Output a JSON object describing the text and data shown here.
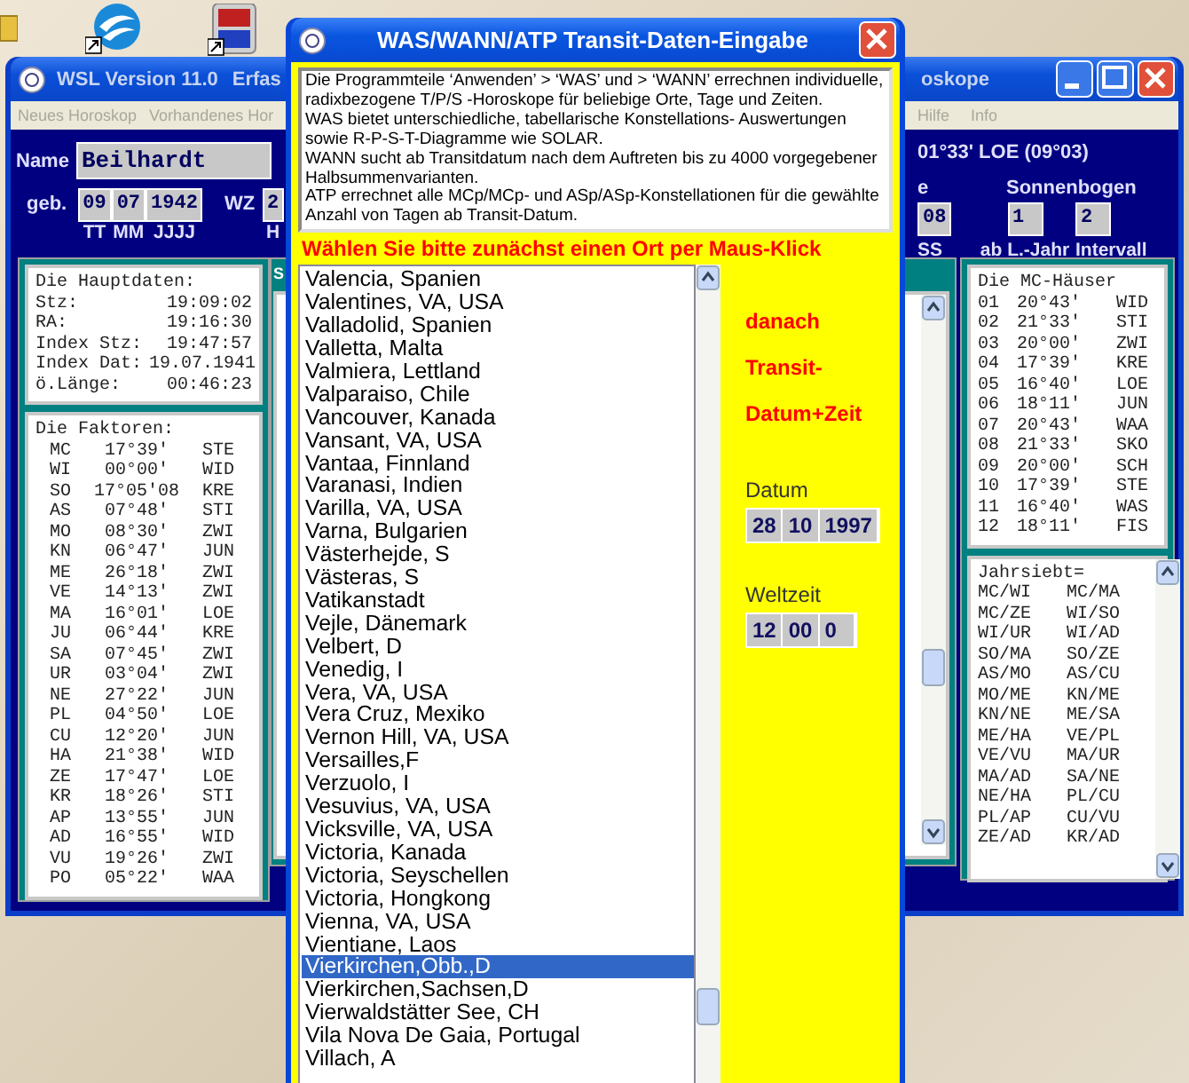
{
  "main_window": {
    "title_fragments": [
      "WSL Version 11.0",
      "Erfas",
      "oskope"
    ],
    "menu": [
      {
        "label": "Neues Horoskop",
        "disabled": true
      },
      {
        "label": "Vorhandenes Hor",
        "disabled": true
      },
      {
        "label": "Hilfe",
        "disabled": true
      },
      {
        "label": "Info",
        "disabled": true
      }
    ],
    "name_label": "Name",
    "name_value": "Beilhardt",
    "birth_label": "geb.",
    "birth_fields": [
      {
        "value": "09",
        "caption": "TT"
      },
      {
        "value": "07",
        "caption": "MM"
      },
      {
        "value": "1942",
        "caption": "JJJJ"
      }
    ],
    "wz_label": "WZ",
    "wz_value": "2",
    "wz_caption": "H",
    "position_text": "01°33' LOE (09°03)",
    "time_label": "e",
    "time_field": {
      "value": "08",
      "caption": "SS"
    },
    "sonnenbogen_label": "Sonnenbogen",
    "sonnenbogen_fields": [
      {
        "value": "1",
        "caption": "ab L.-Jahr"
      },
      {
        "value": "2",
        "caption": "Intervall"
      }
    ],
    "hauptdaten": {
      "title": "Die Hauptdaten:",
      "rows": [
        [
          "Stz:",
          "19:09:02"
        ],
        [
          "RA:",
          "19:16:30"
        ],
        [
          "Index Stz:",
          "19:47:57"
        ],
        [
          "Index Dat:",
          "19.07.1941"
        ],
        [
          "ö.Länge:",
          "00:46:23"
        ]
      ]
    },
    "faktoren": {
      "title": "Die Faktoren:",
      "rows": [
        [
          "MC",
          "17°39'",
          "STE"
        ],
        [
          "WI",
          "00°00'",
          "WID"
        ],
        [
          "SO",
          "17°05'08",
          "KRE"
        ],
        [
          "AS",
          "07°48'",
          "STI"
        ],
        [
          "MO",
          "08°30'",
          "ZWI"
        ],
        [
          "KN",
          "06°47'",
          "JUN"
        ],
        [
          "ME",
          "26°18'",
          "ZWI"
        ],
        [
          "VE",
          "14°13'",
          "ZWI"
        ],
        [
          "MA",
          "16°01'",
          "LOE"
        ],
        [
          "JU",
          "06°44'",
          "KRE"
        ],
        [
          "SA",
          "07°45'",
          "ZWI"
        ],
        [
          "UR",
          "03°04'",
          "ZWI"
        ],
        [
          "NE",
          "27°22'",
          "JUN"
        ],
        [
          "PL",
          "04°50'",
          "LOE"
        ],
        [
          "CU",
          "12°20'",
          "JUN"
        ],
        [
          "HA",
          "21°38'",
          "WID"
        ],
        [
          "ZE",
          "17°47'",
          "LOE"
        ],
        [
          "KR",
          "18°26'",
          "STI"
        ],
        [
          "AP",
          "13°55'",
          "JUN"
        ],
        [
          "AD",
          "16°55'",
          "WID"
        ],
        [
          "VU",
          "19°26'",
          "ZWI"
        ],
        [
          "PO",
          "05°22'",
          "WAA"
        ]
      ]
    },
    "middle_panel_title": "S",
    "mc_haeuser": {
      "title": "Die MC-Häuser",
      "rows": [
        [
          "01",
          "20°43'",
          "WID"
        ],
        [
          "02",
          "21°33'",
          "STI"
        ],
        [
          "03",
          "20°00'",
          "ZWI"
        ],
        [
          "04",
          "17°39'",
          "KRE"
        ],
        [
          "05",
          "16°40'",
          "LOE"
        ],
        [
          "06",
          "18°11'",
          "JUN"
        ],
        [
          "07",
          "20°43'",
          "WAA"
        ],
        [
          "08",
          "21°33'",
          "SKO"
        ],
        [
          "09",
          "20°00'",
          "SCH"
        ],
        [
          "10",
          "17°39'",
          "STE"
        ],
        [
          "11",
          "16°40'",
          "WAS"
        ],
        [
          "12",
          "18°11'",
          "FIS"
        ]
      ]
    },
    "jahrsiebt": {
      "title": "Jahrsiebt=",
      "rows": [
        [
          "MC/WI",
          "MC/MA"
        ],
        [
          "MC/ZE",
          "WI/SO"
        ],
        [
          "WI/UR",
          "WI/AD"
        ],
        [
          "SO/MA",
          "SO/ZE"
        ],
        [
          "AS/MO",
          "AS/CU"
        ],
        [
          "MO/ME",
          "KN/ME"
        ],
        [
          "KN/NE",
          "ME/SA"
        ],
        [
          "ME/HA",
          "VE/PL"
        ],
        [
          "VE/VU",
          "MA/UR"
        ],
        [
          "MA/AD",
          "SA/NE"
        ],
        [
          "NE/HA",
          "PL/CU"
        ],
        [
          "PL/AP",
          "CU/VU"
        ],
        [
          "ZE/AD",
          "KR/AD"
        ]
      ]
    }
  },
  "dialog": {
    "title": "WAS/WANN/ATP Transit-Daten-Eingabe",
    "info": [
      "Die Programmteile  ‘Anwenden’ > ‘WAS’  und  > ‘WANN’ errechnen individuelle, radixbezogene T/P/S -Horoskope für beliebige Orte, Tage und Zeiten.",
      "WAS bietet unterschiedliche, tabellarische Konstellations- Auswertungen sowie R-P-S-T-Diagramme wie SOLAR.",
      "WANN sucht ab Transitdatum nach dem Auftreten bis zu 4000 vorgegebener Halbsummenvarianten.",
      "ATP errechnet alle MCp/MCp- und ASp/ASp-Konstellationen für die gewählte Anzahl von Tagen ab Transit-Datum."
    ],
    "instruction": "Wählen Sie bitte zunächst einen Ort per Maus-Klick",
    "places": [
      {
        "label": "Valencia, Spanien",
        "selected": false
      },
      {
        "label": "Valentines, VA, USA",
        "selected": false
      },
      {
        "label": "Valladolid, Spanien",
        "selected": false
      },
      {
        "label": "Valletta, Malta",
        "selected": false
      },
      {
        "label": "Valmiera, Lettland",
        "selected": false
      },
      {
        "label": "Valparaiso, Chile",
        "selected": false
      },
      {
        "label": "Vancouver, Kanada",
        "selected": false
      },
      {
        "label": "Vansant, VA, USA",
        "selected": false
      },
      {
        "label": "Vantaa, Finnland",
        "selected": false
      },
      {
        "label": "Varanasi, Indien",
        "selected": false
      },
      {
        "label": "Varilla, VA, USA",
        "selected": false
      },
      {
        "label": "Varna, Bulgarien",
        "selected": false
      },
      {
        "label": "Västerhejde, S",
        "selected": false
      },
      {
        "label": "Västeras, S",
        "selected": false
      },
      {
        "label": "Vatikanstadt",
        "selected": false
      },
      {
        "label": "Vejle, Dänemark",
        "selected": false
      },
      {
        "label": "Velbert, D",
        "selected": false
      },
      {
        "label": "Venedig, I",
        "selected": false
      },
      {
        "label": "Vera, VA, USA",
        "selected": false
      },
      {
        "label": "Vera Cruz, Mexiko",
        "selected": false
      },
      {
        "label": "Vernon Hill, VA, USA",
        "selected": false
      },
      {
        "label": "Versailles,F",
        "selected": false
      },
      {
        "label": "Verzuolo, I",
        "selected": false
      },
      {
        "label": "Vesuvius, VA, USA",
        "selected": false
      },
      {
        "label": "Vicksville, VA, USA",
        "selected": false
      },
      {
        "label": "Victoria, Kanada",
        "selected": false
      },
      {
        "label": "Victoria, Seyschellen",
        "selected": false
      },
      {
        "label": "Victoria, Hongkong",
        "selected": false
      },
      {
        "label": "Vienna, VA, USA",
        "selected": false
      },
      {
        "label": "Vientiane, Laos",
        "selected": false
      },
      {
        "label": "Vierkirchen,Obb.,D",
        "selected": true
      },
      {
        "label": "Vierkirchen,Sachsen,D",
        "selected": false
      },
      {
        "label": "Vierwaldstätter See, CH",
        "selected": false
      },
      {
        "label": "Vila Nova De Gaia, Portugal",
        "selected": false
      },
      {
        "label": "Villach, A",
        "selected": false
      }
    ],
    "hint_lines": [
      "danach",
      "Transit-",
      "Datum+Zeit"
    ],
    "date_label": "Datum",
    "date_fields": [
      "28",
      "10",
      "1997"
    ],
    "time_label": "Weltzeit",
    "time_fields": [
      "12",
      "00",
      "0"
    ]
  }
}
